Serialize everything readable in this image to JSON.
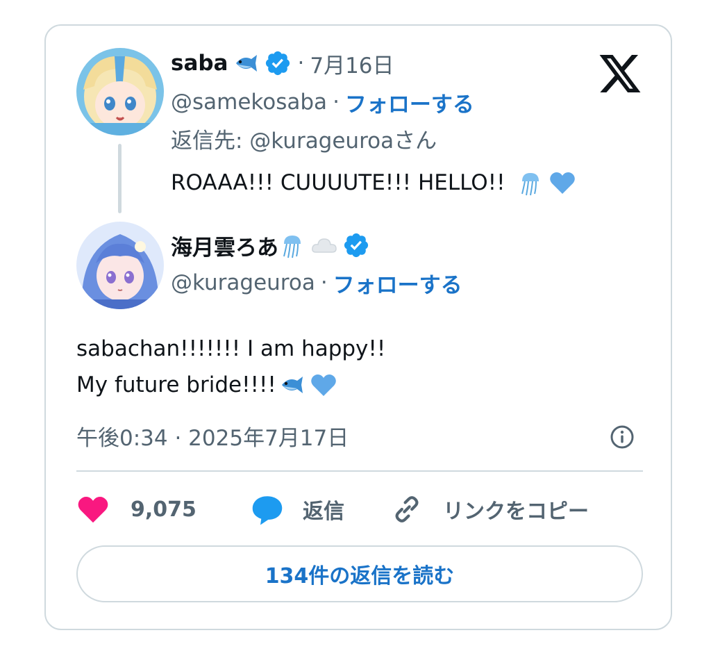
{
  "reply_tweet": {
    "author_name": "saba",
    "author_emoji": "fish-icon",
    "verified": true,
    "date": "7月16日",
    "handle": "@samekosaba",
    "follow_label": "フォローする",
    "replying_to": "返信先: @kurageuroaさん",
    "text": "ROAAA!!! CUUUUTE!!! HELLO!!"
  },
  "main_tweet": {
    "author_name": "海月雲ろあ",
    "author_emojis": [
      "jellyfish-icon",
      "cloud-icon"
    ],
    "verified": true,
    "handle": "@kurageuroa",
    "follow_label": "フォローする",
    "text_line1": "sabachan!!!!!!! I am happy!!",
    "text_line2": "My future bride!!!!",
    "timestamp": "午後0:34 · 2025年7月17日"
  },
  "actions": {
    "like_count": "9,075",
    "reply_label": "返信",
    "copy_link_label": "リンクをコピー"
  },
  "read_replies_label": "134件の返信を読む",
  "colors": {
    "accent": "#1a73c8",
    "verified_blue": "#1d9bf0",
    "like_pink": "#f91880",
    "heart_blue": "#5fa8e8",
    "secondary_text": "#536471",
    "border": "#cfd9de"
  }
}
